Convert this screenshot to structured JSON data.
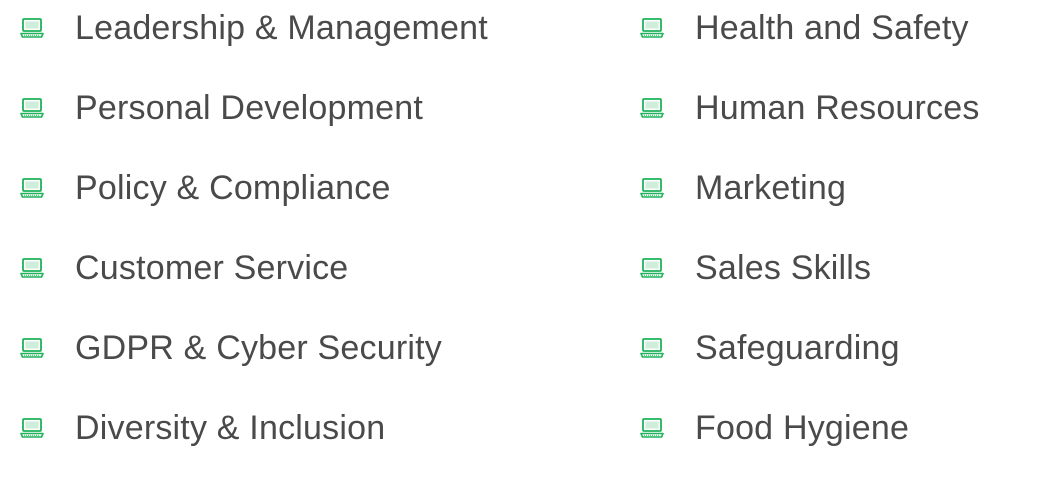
{
  "colors": {
    "icon_accent": "#1fb35a",
    "text": "#4a4a4a"
  },
  "icon": "laptop-icon",
  "courses": {
    "left": [
      {
        "label": "Leadership & Management"
      },
      {
        "label": "Personal Development"
      },
      {
        "label": "Policy & Compliance"
      },
      {
        "label": "Customer Service"
      },
      {
        "label": "GDPR & Cyber Security"
      },
      {
        "label": "Diversity & Inclusion"
      }
    ],
    "right": [
      {
        "label": "Health and Safety"
      },
      {
        "label": "Human Resources"
      },
      {
        "label": "Marketing"
      },
      {
        "label": "Sales Skills"
      },
      {
        "label": "Safeguarding"
      },
      {
        "label": "Food Hygiene"
      }
    ]
  }
}
